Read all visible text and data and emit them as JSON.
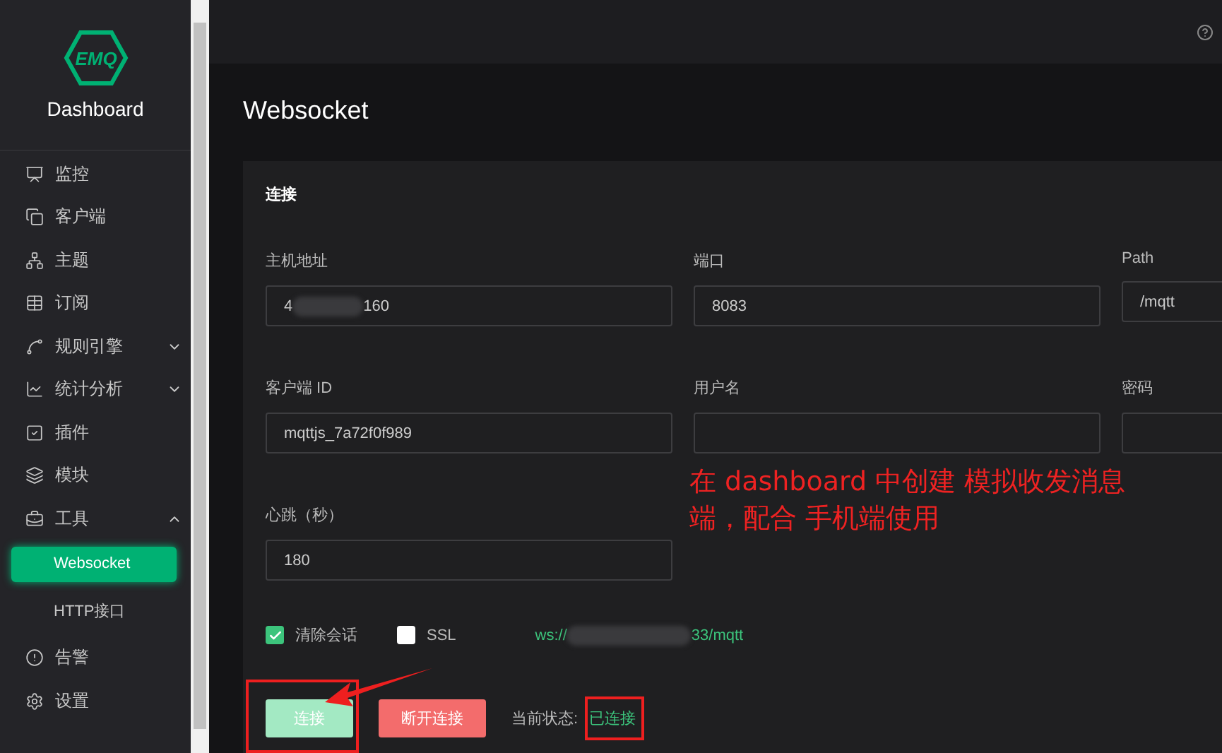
{
  "sidebar": {
    "logo": "EMQ",
    "title": "Dashboard",
    "items": [
      {
        "label": "监控",
        "selected": false
      },
      {
        "label": "客户端",
        "selected": false
      },
      {
        "label": "主题",
        "selected": false
      },
      {
        "label": "订阅",
        "selected": false
      },
      {
        "label": "规则引擎",
        "selected": false,
        "expanded": false
      },
      {
        "label": "统计分析",
        "selected": false,
        "expanded": false
      },
      {
        "label": "插件",
        "selected": false
      },
      {
        "label": "模块",
        "selected": false
      },
      {
        "label": "工具",
        "selected": false,
        "expanded": true,
        "children": [
          {
            "label": "Websocket",
            "selected": true
          },
          {
            "label": "HTTP接口",
            "selected": false
          }
        ]
      },
      {
        "label": "告警",
        "selected": false
      },
      {
        "label": "设置",
        "selected": false
      }
    ]
  },
  "page_title": "Websocket",
  "card": {
    "title": "连接",
    "fields": [
      {
        "label": "主机地址",
        "value_parts": [
          "4",
          "160"
        ]
      },
      {
        "label": "端口",
        "value_parts": [
          "8083"
        ]
      },
      {
        "label": "Path",
        "value_parts": [
          "/mqtt"
        ]
      },
      {
        "label": "客户端 ID",
        "value_parts": [
          "mqttjs_7a72f0f989"
        ]
      },
      {
        "label": "用户名"
      },
      {
        "label": "密码"
      },
      {
        "label": "心跳（秒）",
        "value_parts": [
          "180"
        ]
      }
    ],
    "checkboxes": [
      {
        "label": "清除会话",
        "checked": true
      },
      {
        "label": "SSL",
        "checked": false
      }
    ],
    "url_parts": [
      "ws://",
      "33/mqtt"
    ],
    "buttons": [
      {
        "label": "连接",
        "kind": "primary",
        "disabled": true
      },
      {
        "label": "断开连接",
        "kind": "danger",
        "disabled": false
      }
    ],
    "status_label": "当前状态:",
    "status": "已连接"
  },
  "annotation": {
    "lines": [
      "在 dashboard 中创建 模拟收发消息",
      "端，配合 手机端使用"
    ]
  }
}
